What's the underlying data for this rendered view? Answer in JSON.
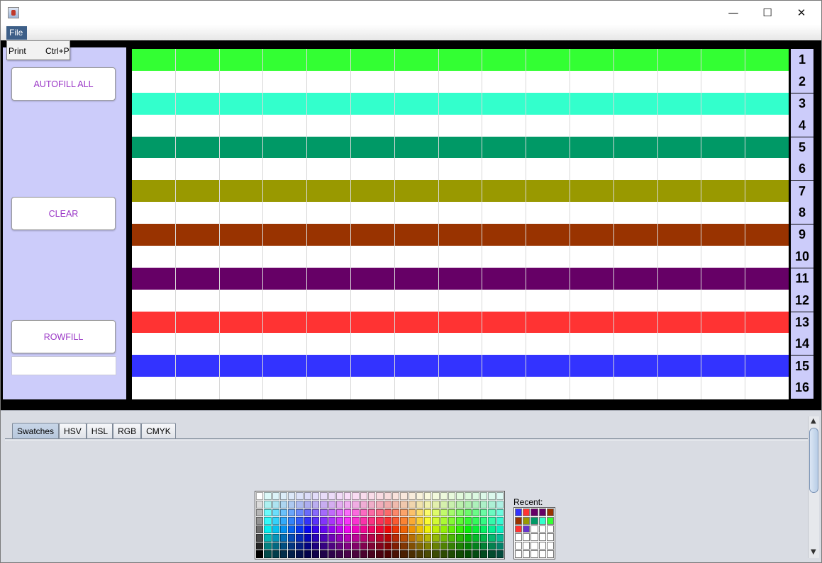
{
  "window": {
    "minimize_glyph": "—",
    "maximize_glyph": "☐",
    "close_glyph": "✕"
  },
  "menu": {
    "file_label": "File",
    "dropdown": {
      "item_label": "Print",
      "item_shortcut": "Ctrl+P"
    }
  },
  "left_panel": {
    "autofill_label": "AUTOFILL ALL",
    "clear_label": "CLEAR",
    "rowfill_label": "ROWFILL",
    "rowfill_value": ""
  },
  "grid": {
    "columns": 15,
    "rows": [
      {
        "number": "1",
        "color": "#33ff33"
      },
      {
        "number": "2",
        "color": "#ffffff"
      },
      {
        "number": "3",
        "color": "#33ffcc"
      },
      {
        "number": "4",
        "color": "#ffffff"
      },
      {
        "number": "5",
        "color": "#009966"
      },
      {
        "number": "6",
        "color": "#ffffff"
      },
      {
        "number": "7",
        "color": "#999900"
      },
      {
        "number": "8",
        "color": "#ffffff"
      },
      {
        "number": "9",
        "color": "#993300"
      },
      {
        "number": "10",
        "color": "#ffffff"
      },
      {
        "number": "11",
        "color": "#660066"
      },
      {
        "number": "12",
        "color": "#ffffff"
      },
      {
        "number": "13",
        "color": "#ff3333"
      },
      {
        "number": "14",
        "color": "#ffffff"
      },
      {
        "number": "15",
        "color": "#3333ff"
      },
      {
        "number": "16",
        "color": "#ffffff"
      }
    ]
  },
  "color_chooser": {
    "tabs": [
      {
        "label": "Swatches",
        "active": true
      },
      {
        "label": "HSV",
        "active": false
      },
      {
        "label": "HSL",
        "active": false
      },
      {
        "label": "RGB",
        "active": false
      },
      {
        "label": "CMYK",
        "active": false
      }
    ],
    "recent_label": "Recent:",
    "recent_colors": [
      "#3333ff",
      "#ff3333",
      "#660066",
      "#660066",
      "#993300",
      "#993300",
      "#999900",
      "#009966",
      "#33ffcc",
      "#33ff33",
      "#ff3333",
      "#6633cc",
      "#ffffff",
      "#ffffff",
      "#ffffff",
      "#ffffff",
      "#ffffff",
      "#ffffff",
      "#ffffff",
      "#ffffff",
      "#ffffff",
      "#ffffff",
      "#ffffff",
      "#ffffff",
      "#ffffff",
      "#ffffff",
      "#ffffff",
      "#ffffff",
      "#ffffff",
      "#ffffff"
    ]
  }
}
